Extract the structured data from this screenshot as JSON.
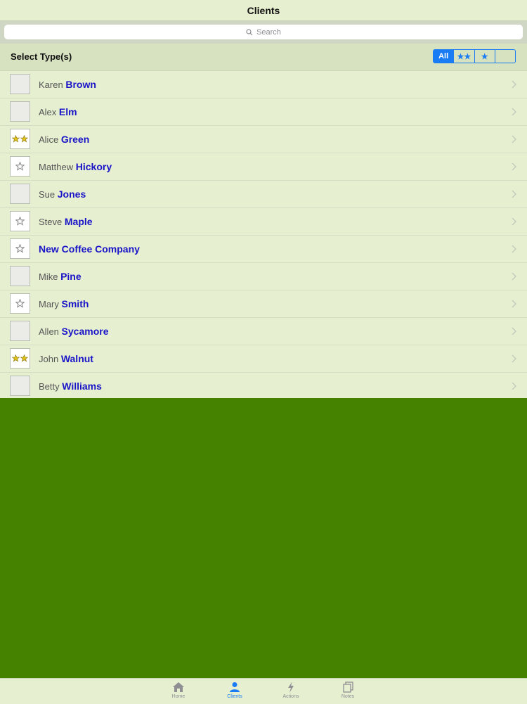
{
  "nav": {
    "title": "Clients"
  },
  "search": {
    "placeholder": "Search",
    "icon": "search-icon"
  },
  "filter": {
    "label": "Select Type(s)",
    "segments": [
      {
        "label": "All",
        "active": true
      },
      {
        "label": "★★",
        "active": false
      },
      {
        "label": "★",
        "active": false
      },
      {
        "label": "",
        "active": false
      }
    ]
  },
  "clients": [
    {
      "first": "Karen",
      "last": "Brown",
      "stars": 0
    },
    {
      "first": "Alex",
      "last": "Elm",
      "stars": 0
    },
    {
      "first": "Alice",
      "last": "Green",
      "stars": 2
    },
    {
      "first": "Matthew",
      "last": "Hickory",
      "stars": 1
    },
    {
      "first": "Sue",
      "last": "Jones",
      "stars": 0
    },
    {
      "first": "Steve",
      "last": "Maple",
      "stars": 1
    },
    {
      "first": "",
      "last": "New Coffee Company",
      "stars": 1
    },
    {
      "first": "Mike",
      "last": "Pine",
      "stars": 0
    },
    {
      "first": "Mary",
      "last": "Smith",
      "stars": 1
    },
    {
      "first": "Allen",
      "last": "Sycamore",
      "stars": 0
    },
    {
      "first": "John",
      "last": "Walnut",
      "stars": 2
    },
    {
      "first": "Betty",
      "last": "Williams",
      "stars": 0
    }
  ],
  "tabs": [
    {
      "label": "Home",
      "icon": "home-icon",
      "active": false
    },
    {
      "label": "Clients",
      "icon": "person-icon",
      "active": true
    },
    {
      "label": "Actions",
      "icon": "lightning-icon",
      "active": false
    },
    {
      "label": "Notes",
      "icon": "notes-icon",
      "active": false
    }
  ],
  "colors": {
    "accent": "#1a7cf5",
    "background": "#e6efd0",
    "green_area": "#458200",
    "last_name": "#1a14c8"
  }
}
